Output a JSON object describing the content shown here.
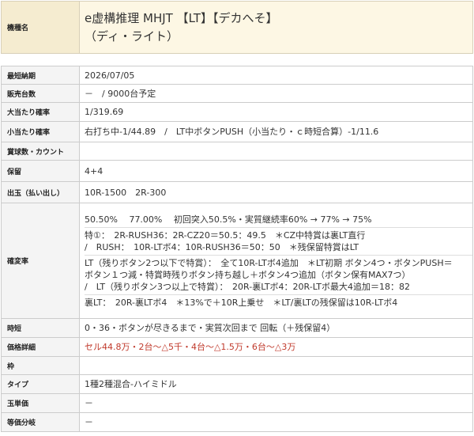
{
  "header": {
    "label": "機種名",
    "title_line1": "e虚構推理 MHJT 【LT】【デカへそ】",
    "title_line2": "（ディ・ライト）"
  },
  "rows": {
    "release": {
      "label": "最短納期",
      "value": "2026/07/05"
    },
    "units": {
      "label": "販売台数",
      "value": "－　/ 9000台予定"
    },
    "big_prob": {
      "label": "大当たり確率",
      "value": "1/319.69"
    },
    "small_prob": {
      "label": "小当たり確率",
      "value": "右打ち中-1/44.89　/　LT中ボタンPUSH（小当たり・ｃ時短合算）-1/11.6"
    },
    "count": {
      "label": "賞球数・カウント",
      "value": ""
    },
    "hold": {
      "label": "保留",
      "value": "4+4"
    },
    "payout": {
      "label": "出玉（払い出し）",
      "value": "10R-1500　2R-300"
    },
    "rates": {
      "label": "確変率",
      "lines": [
        "50.50%　 77.00%　 初回突入50.5%・実質継続率60% → 77% → 75%",
        "特①：　2R-RUSH36：2R-CZ20＝50.5：49.5　＊CZ中特賞は裏LT直行",
        "/　RUSH：　10R-LTボ4：10R-RUSH36＝50：50　＊残保留特賞はLT",
        "LT（残りボタン2つ以下で特賞）：　全て10R-LTボ4追加　＊LT初期 ボタン4つ・ボタンPUSH＝",
        "ボタン１つ減・特賞時残りボタン持ち越し＋ボタン4つ追加（ボタン保有MAX7つ）",
        "/　LT（残りボタン3つ以上で特賞）：　20R-裏LTボ4：20R-LTボ最大4追加＝18：82",
        "裏LT：　20R-裏LTボ4　＊13%で＋10R上乗せ　＊LT/裏LTの残保留は10R-LTボ4"
      ]
    },
    "jitan": {
      "label": "時短",
      "value": "0・36・ボタンが尽きるまで・実質次回まで 回転（＋残保留4）"
    },
    "price": {
      "label": "価格詳細",
      "value": "セル44.8万・2台～△5千・4台～△1.5万・6台～△3万"
    },
    "frame": {
      "label": "枠",
      "value": ""
    },
    "type": {
      "label": "タイプ",
      "value": "1種2種混合-ハイミドル"
    },
    "ball_price": {
      "label": "玉単価",
      "value": "－"
    },
    "equiv": {
      "label": "等価分岐",
      "value": "－"
    }
  },
  "colors": {
    "header_bg": "#fdf7e4",
    "label_bg": "#f4f4f4",
    "price_text": "#c0392b"
  }
}
